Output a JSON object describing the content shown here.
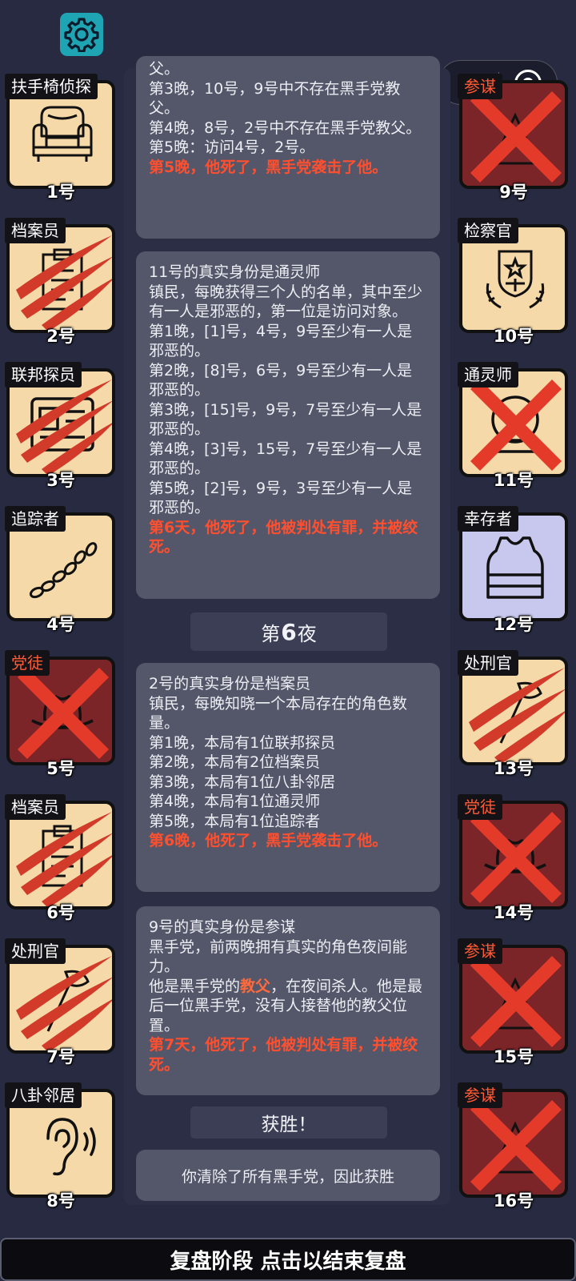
{
  "header": {
    "settings_icon": "gear-icon"
  },
  "capsule": {
    "menu_icon": "more-dots-icon",
    "close_icon": "target-circle-icon"
  },
  "logs": [
    {
      "lines": [
        "父。",
        "第3晚，10号，9号中不存在黑手党教父。",
        "第4晚，8号，2号中不存在黑手党教父。",
        "第5晚：访问4号，2号。"
      ],
      "death": "第5晚，他死了，黑手党袭击了他。"
    },
    {
      "lines": [
        "11号的真实身份是通灵师",
        "镇民，每晚获得三个人的名单，其中至少有一人是邪恶的，第一位是访问对象。",
        "第1晚，[1]号，4号，9号至少有一人是邪恶的。",
        "第2晚，[8]号，6号，9号至少有一人是邪恶的。",
        "第3晚，[15]号，9号，7号至少有一人是邪恶的。",
        "第4晚，[3]号，15号，7号至少有一人是邪恶的。",
        "第5晚，[2]号，9号，3号至少有一人是邪恶的。"
      ],
      "death": "第6天，他死了，他被判处有罪，并被绞死。"
    },
    {
      "lines": [
        "2号的真实身份是档案员",
        "镇民，每晚知晓一个本局存在的角色数量。",
        "第1晚，本局有1位联邦探员",
        "第2晚，本局有2位档案员",
        "第3晚，本局有1位八卦邻居",
        "第4晚，本局有1位通灵师",
        "第5晚，本局有1位追踪者"
      ],
      "death": "第6晚，他死了，黑手党袭击了他。"
    },
    {
      "line1": "9号的真实身份是参谋",
      "line2": "黑手党，前两晚拥有真实的角色夜间能力。",
      "line3_pre": "他是黑手党的",
      "line3_hl": "教父",
      "line3_post": "，在夜间杀人。他是最后一位黑手党，没有人接替他的教父位置。",
      "death": "第7天，他死了，他被判处有罪，并被绞死。"
    }
  ],
  "night_divider": {
    "prefix": "第",
    "number": "6",
    "suffix": "夜"
  },
  "victory": {
    "title": "获胜！",
    "message": "你清除了所有黑手党，因此获胜"
  },
  "players_left": [
    {
      "role": "扶手椅侦探",
      "seat": "1号",
      "icon": "armchair-icon",
      "state": "alive"
    },
    {
      "role": "档案员",
      "seat": "2号",
      "icon": "clipboard-icon",
      "state": "slashed"
    },
    {
      "role": "联邦探员",
      "seat": "3号",
      "icon": "badge-id-icon",
      "state": "slashed"
    },
    {
      "role": "追踪者",
      "seat": "4号",
      "icon": "footprints-icon",
      "state": "alive"
    },
    {
      "role": "党徒",
      "seat": "5号",
      "icon": "fedora-hat-icon",
      "state": "crossed"
    },
    {
      "role": "档案员",
      "seat": "6号",
      "icon": "clipboard-icon",
      "state": "slashed"
    },
    {
      "role": "处刑官",
      "seat": "7号",
      "icon": "axe-icon",
      "state": "slashed"
    },
    {
      "role": "八卦邻居",
      "seat": "8号",
      "icon": "ear-icon",
      "state": "alive"
    }
  ],
  "players_right": [
    {
      "role": "参谋",
      "seat": "9号",
      "icon": "mafia-icon",
      "state": "crossed"
    },
    {
      "role": "检察官",
      "seat": "10号",
      "icon": "justice-emblem-icon",
      "state": "alive"
    },
    {
      "role": "通灵师",
      "seat": "11号",
      "icon": "crystal-ball-icon",
      "state": "crossed-light"
    },
    {
      "role": "幸存者",
      "seat": "12号",
      "icon": "vest-icon",
      "state": "alive-blue"
    },
    {
      "role": "处刑官",
      "seat": "13号",
      "icon": "axe-icon",
      "state": "slashed"
    },
    {
      "role": "党徒",
      "seat": "14号",
      "icon": "fedora-hat-icon",
      "state": "crossed"
    },
    {
      "role": "参谋",
      "seat": "15号",
      "icon": "mafia-icon",
      "state": "crossed"
    },
    {
      "role": "参谋",
      "seat": "16号",
      "icon": "mafia-icon",
      "state": "crossed"
    }
  ],
  "footer": {
    "label": "复盘阶段 点击以结束复盘"
  },
  "colors": {
    "background": "#272a40",
    "panel": "#545769",
    "death_text": "#ff4f2f",
    "card": "#f6d9a8",
    "dead_card": "#7c2529",
    "accent": "#1fa4b3"
  }
}
